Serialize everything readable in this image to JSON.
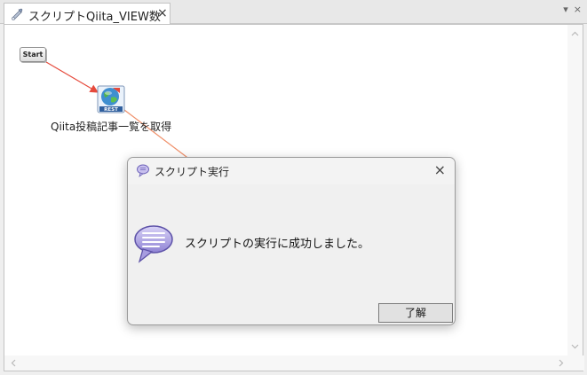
{
  "tab": {
    "label": "スクリプトQiita_VIEW数",
    "close": "×"
  },
  "strip_controls": {
    "dropdown": "▾",
    "close": "×"
  },
  "canvas": {
    "start_node": {
      "label": "Start"
    },
    "rest_node": {
      "label": "Qiita投稿記事一覧を取得",
      "badge": "REST"
    }
  },
  "dialog": {
    "title": "スクリプト実行",
    "close": "×",
    "message": "スクリプトの実行に成功しました。",
    "ok_label": "了解"
  },
  "colors": {
    "connector": "#e64a3c",
    "connector_secondary": "#f0906a",
    "dialog_icon": "#9b8fd8"
  },
  "icons": {
    "tab": "script-icon",
    "dialog_title": "speech-bubble-icon",
    "dialog_message": "speech-bubble-icon",
    "rest_node": "rest-globe-icon"
  }
}
